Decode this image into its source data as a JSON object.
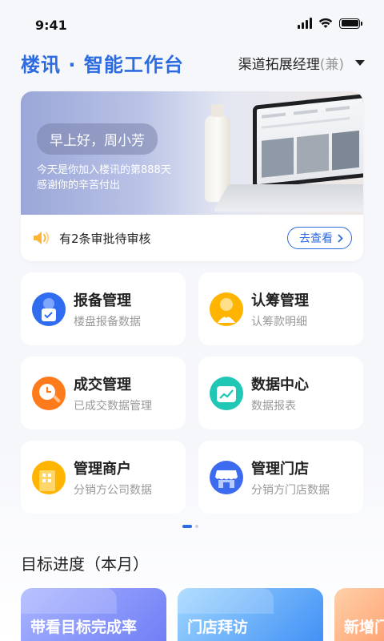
{
  "status_bar": {
    "time": "9:41"
  },
  "header": {
    "app_title": "楼讯 · 智能工作台",
    "role": "渠道拓展经理",
    "role_suffix": "(兼)"
  },
  "banner": {
    "greeting": "早上好，周小芳",
    "line1": "今天是你加入楼讯的第888天",
    "line2": "感谢你的辛苦付出"
  },
  "notice": {
    "icon": "speaker-icon",
    "text": "有2条审批待审核",
    "action": "去查看"
  },
  "modules": [
    {
      "name": "报备管理",
      "desc": "楼盘报备数据",
      "icon": "report-icon",
      "color": "#2f6cf0"
    },
    {
      "name": "认筹管理",
      "desc": "认筹款明细",
      "icon": "subscription-icon",
      "color": "#ffb400"
    },
    {
      "name": "成交管理",
      "desc": "已成交数据管理",
      "icon": "deal-icon",
      "color": "#ff7a1a"
    },
    {
      "name": "数据中心",
      "desc": "数据报表",
      "icon": "data-chart-icon",
      "color": "#1fc7b4"
    },
    {
      "name": "管理商户",
      "desc": "分销方公司数据",
      "icon": "merchant-building-icon",
      "color": "#ffb400"
    },
    {
      "name": "管理门店",
      "desc": "分销方门店数据",
      "icon": "store-icon",
      "color": "#3d6bf0"
    }
  ],
  "goals_section": {
    "title": "目标进度（本月）",
    "cards": [
      {
        "label": "带看目标完成率"
      },
      {
        "label": "门店拜访"
      },
      {
        "label": "新增门"
      }
    ]
  },
  "colors": {
    "accent": "#2d6be0",
    "background": "#f6f7fb"
  }
}
